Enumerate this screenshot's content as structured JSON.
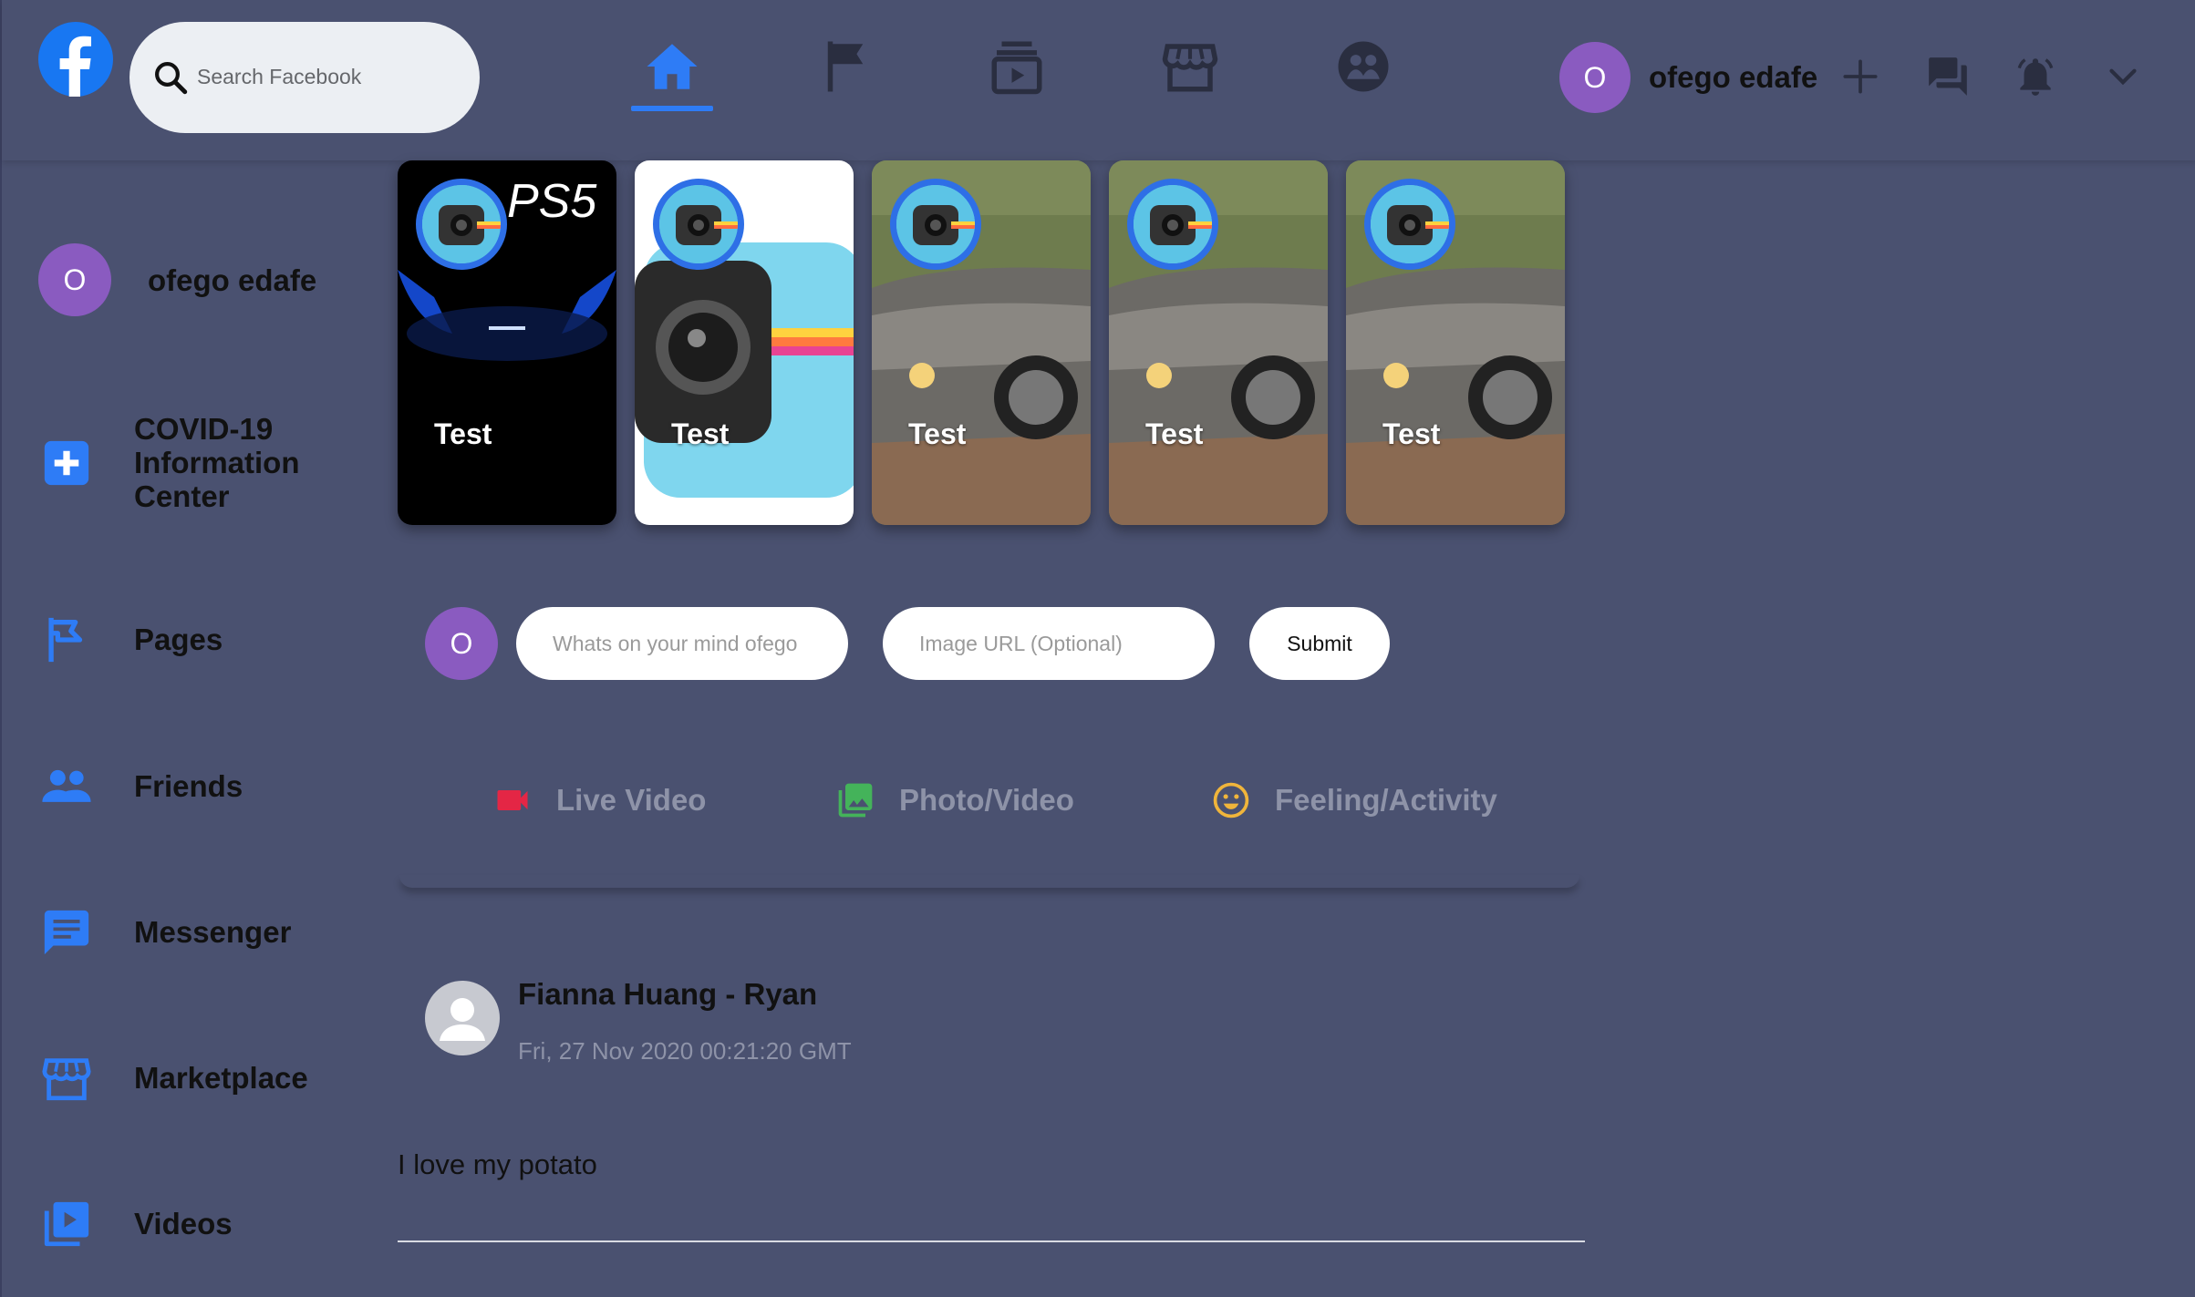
{
  "header": {
    "search_placeholder": "Search Facebook",
    "nav_tabs": [
      {
        "name": "home",
        "active": true
      },
      {
        "name": "pages"
      },
      {
        "name": "watch"
      },
      {
        "name": "marketplace"
      },
      {
        "name": "groups"
      }
    ],
    "user": {
      "initial": "O",
      "name": "ofego edafe"
    }
  },
  "sidebar": {
    "user": {
      "initial": "O",
      "name": "ofego edafe"
    },
    "items": [
      {
        "label": "COVID-19\nInformation\nCenter",
        "icon": "plus-square-icon"
      },
      {
        "label": "Pages",
        "icon": "flag-icon"
      },
      {
        "label": "Friends",
        "icon": "people-icon"
      },
      {
        "label": "Messenger",
        "icon": "chat-icon"
      },
      {
        "label": "Marketplace",
        "icon": "store-icon"
      },
      {
        "label": "Videos",
        "icon": "video-library-icon"
      }
    ]
  },
  "stories": [
    {
      "title": "Test",
      "theme": "ps5"
    },
    {
      "title": "Test",
      "theme": "camera"
    },
    {
      "title": "Test",
      "theme": "car"
    },
    {
      "title": "Test",
      "theme": "car"
    },
    {
      "title": "Test",
      "theme": "car"
    }
  ],
  "composer": {
    "initial": "O",
    "post_placeholder": "Whats on your mind ofego",
    "image_placeholder": "Image URL (Optional)",
    "submit_label": "Submit",
    "actions": [
      {
        "label": "Live Video",
        "color": "#e42645"
      },
      {
        "label": "Photo/Video",
        "color": "#44b35a"
      },
      {
        "label": "Feeling/Activity",
        "color": "#f0b53b"
      }
    ]
  },
  "post": {
    "author": "Fianna Huang - Ryan",
    "timestamp": "Fri, 27 Nov 2020 00:21:20 GMT",
    "text": "I love my potato"
  },
  "colors": {
    "accent": "#2e7cf6",
    "background": "#4a5170",
    "avatar": "#8a5bc0"
  }
}
